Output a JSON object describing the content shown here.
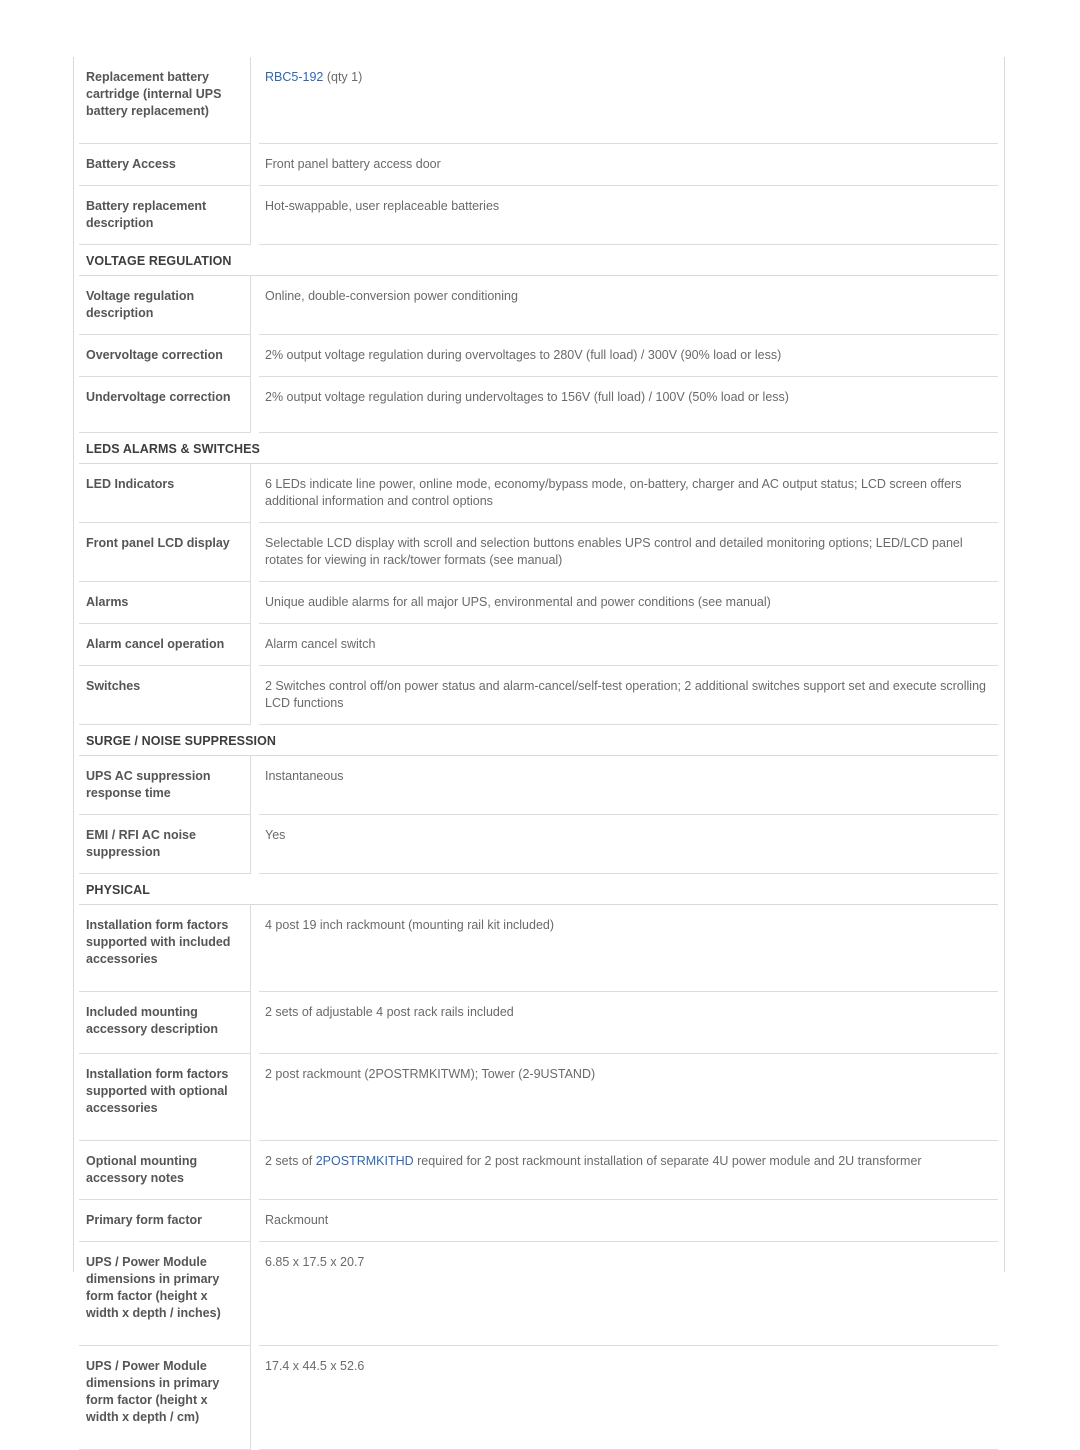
{
  "document": {
    "type": "product-specification-table",
    "link_color": "#2f66b5",
    "label_color": "#555555",
    "value_color": "#6a6a6a",
    "section_color": "#3d3d3d",
    "border_color": "#dcdcdc"
  },
  "rows": [
    {
      "kind": "spec",
      "size": "tall",
      "label": "Replacement battery cartridge (internal UPS battery replacement)",
      "value_prefix": "",
      "link": "RBC5-192",
      "value_suffix": " (qty 1)"
    },
    {
      "kind": "spec",
      "size": "one",
      "label": "Battery Access",
      "value": "Front panel battery access door"
    },
    {
      "kind": "spec",
      "size": "two",
      "label": "Battery replacement description",
      "value": "Hot-swappable, user replaceable batteries"
    },
    {
      "kind": "section",
      "title": "VOLTAGE REGULATION"
    },
    {
      "kind": "spec",
      "size": "med",
      "label": "Voltage regulation description",
      "value": "Online, double-conversion power conditioning"
    },
    {
      "kind": "spec",
      "size": "one",
      "label": "Overvoltage correction",
      "value": "2% output voltage regulation during overvoltages to 280V (full load) / 300V (90% load or less)"
    },
    {
      "kind": "spec",
      "size": "med",
      "label": "Undervoltage correction",
      "value": "2% output voltage regulation during undervoltages to 156V (full load) / 100V (50% load or less)"
    },
    {
      "kind": "section",
      "title": "LEDS ALARMS & SWITCHES"
    },
    {
      "kind": "spec",
      "size": "med",
      "label": "LED Indicators",
      "value": "6 LEDs indicate line power, online mode, economy/bypass mode, on-battery, charger and AC output status; LCD screen offers additional information and control options"
    },
    {
      "kind": "spec",
      "size": "med",
      "label": "Front panel LCD display",
      "value": "Selectable LCD display with scroll and selection buttons enables UPS control and detailed monitoring options; LED/LCD panel rotates for viewing in rack/tower formats (see manual)"
    },
    {
      "kind": "spec",
      "size": "one",
      "label": "Alarms",
      "value": "Unique audible alarms for all major UPS, environmental and power conditions (see manual)"
    },
    {
      "kind": "spec",
      "size": "one",
      "label": "Alarm cancel operation",
      "value": "Alarm cancel switch"
    },
    {
      "kind": "spec",
      "size": "med",
      "label": "Switches",
      "value": "2 Switches control off/on power status and alarm-cancel/self-test operation; 2 additional switches support set and execute scrolling LCD functions"
    },
    {
      "kind": "section",
      "title": "SURGE / NOISE SUPPRESSION"
    },
    {
      "kind": "spec",
      "size": "med",
      "label": "UPS AC suppression response time",
      "value": "Instantaneous"
    },
    {
      "kind": "spec",
      "size": "med",
      "label": "EMI / RFI AC noise suppression",
      "value": "Yes"
    },
    {
      "kind": "section",
      "title": "PHYSICAL"
    },
    {
      "kind": "spec",
      "size": "tall",
      "label": "Installation form factors supported with included accessories",
      "value": "4 post 19 inch rackmount (mounting rail kit included)"
    },
    {
      "kind": "spec",
      "size": "med2",
      "label": "Included mounting accessory description",
      "value": "2 sets of adjustable 4 post rack rails included"
    },
    {
      "kind": "spec",
      "size": "tall",
      "label": "Installation form factors supported with optional accessories",
      "value": "2 post rackmount (2POSTRMKITWM); Tower (2-9USTAND)"
    },
    {
      "kind": "spec",
      "size": "med",
      "label": "Optional mounting accessory notes",
      "value_prefix": "2 sets of ",
      "link": "2POSTRMKITHD",
      "value_suffix": " required for 2 post rackmount installation of separate 4U power module and 2U transformer"
    },
    {
      "kind": "spec",
      "size": "one",
      "label": "Primary form factor",
      "value": "Rackmount"
    },
    {
      "kind": "spec",
      "size": "quad",
      "label": "UPS / Power Module dimensions in primary form factor (height x width x depth / inches)",
      "value": "6.85 x 17.5 x 20.7"
    },
    {
      "kind": "spec",
      "size": "quad",
      "label": "UPS / Power Module dimensions in primary form factor (height x width x depth / cm)",
      "value": "17.4 x 44.5 x 52.6"
    }
  ]
}
